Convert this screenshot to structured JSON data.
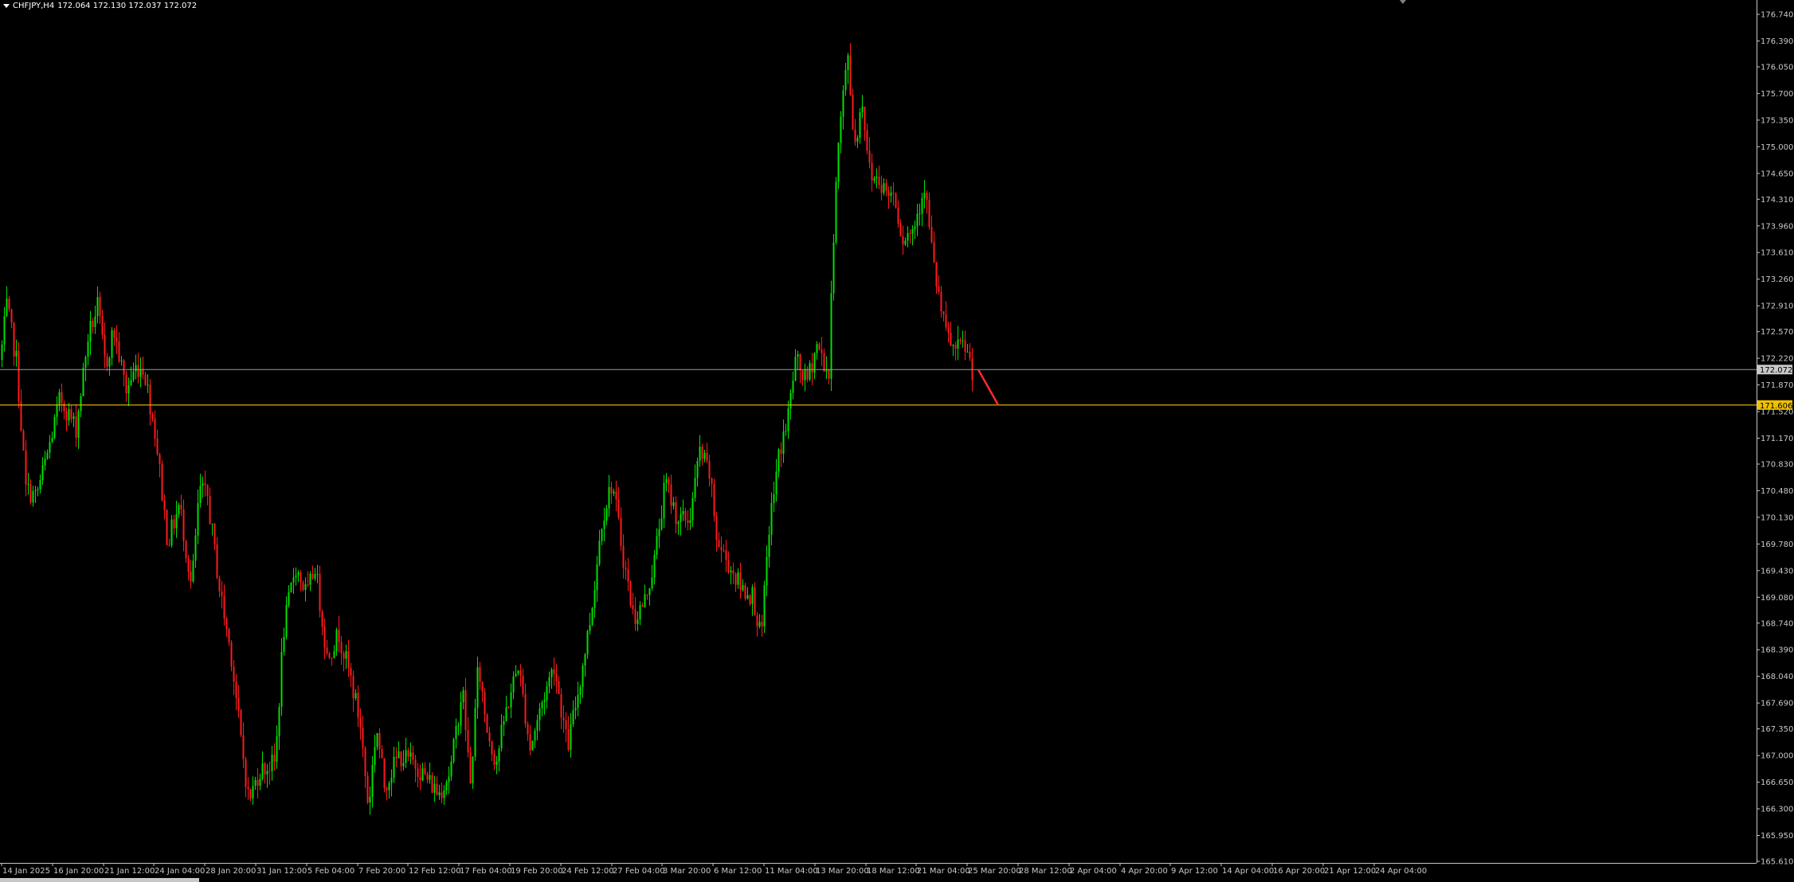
{
  "header": {
    "symbol": "CHFJPY,H4",
    "ohlc": "172.064 172.130 172.037 172.072"
  },
  "colors": {
    "background": "#000000",
    "bull": "#00e000",
    "bear": "#ff1a1a",
    "axis": "#c8c8c8",
    "bid_line": "#9a9a9a",
    "level_line": "#f0c000",
    "trend_line": "#ff2a2a"
  },
  "price_labels": {
    "current": "172.072",
    "level": "171.606"
  },
  "chart_data": {
    "type": "candlestick",
    "timeframe": "H4",
    "y_ticks": [
      "176.740",
      "176.390",
      "176.050",
      "175.700",
      "175.350",
      "175.000",
      "174.650",
      "174.310",
      "173.960",
      "173.610",
      "173.260",
      "172.910",
      "172.570",
      "172.220",
      "171.870",
      "171.520",
      "171.170",
      "170.830",
      "170.480",
      "170.130",
      "169.780",
      "169.430",
      "169.080",
      "168.740",
      "168.390",
      "168.040",
      "167.690",
      "167.350",
      "167.000",
      "166.650",
      "166.300",
      "165.950",
      "165.610"
    ],
    "x_ticks": [
      "14 Jan 2025",
      "16 Jan 20:00",
      "21 Jan 12:00",
      "24 Jan 04:00",
      "28 Jan 20:00",
      "31 Jan 12:00",
      "5 Feb 04:00",
      "7 Feb 20:00",
      "12 Feb 12:00",
      "17 Feb 04:00",
      "19 Feb 20:00",
      "24 Feb 12:00",
      "27 Feb 04:00",
      "3 Mar 20:00",
      "6 Mar 12:00",
      "11 Mar 04:00",
      "13 Mar 20:00",
      "18 Mar 12:00",
      "21 Mar 04:00",
      "25 Mar 20:00",
      "28 Mar 12:00",
      "2 Apr 04:00",
      "4 Apr 20:00",
      "9 Apr 12:00",
      "14 Apr 04:00",
      "16 Apr 20:00",
      "21 Apr 12:00",
      "24 Apr 04:00"
    ],
    "ylim": [
      165.61,
      176.74
    ],
    "current_price": 172.072,
    "horizontal_level": 171.606,
    "anchors": [
      [
        0,
        172.2
      ],
      [
        8,
        172.9
      ],
      [
        20,
        172.2
      ],
      [
        32,
        170.5
      ],
      [
        45,
        170.4
      ],
      [
        60,
        171.0
      ],
      [
        75,
        171.7
      ],
      [
        95,
        171.3
      ],
      [
        110,
        172.5
      ],
      [
        122,
        172.9
      ],
      [
        132,
        172.1
      ],
      [
        142,
        172.6
      ],
      [
        158,
        171.8
      ],
      [
        170,
        172.1
      ],
      [
        180,
        172.1
      ],
      [
        195,
        171.2
      ],
      [
        210,
        169.8
      ],
      [
        225,
        170.3
      ],
      [
        240,
        169.2
      ],
      [
        250,
        170.5
      ],
      [
        260,
        170.4
      ],
      [
        275,
        169.2
      ],
      [
        290,
        168.3
      ],
      [
        302,
        167.2
      ],
      [
        312,
        166.4
      ],
      [
        325,
        166.8
      ],
      [
        345,
        166.9
      ],
      [
        355,
        168.6
      ],
      [
        370,
        169.5
      ],
      [
        385,
        169.1
      ],
      [
        395,
        169.5
      ],
      [
        410,
        168.3
      ],
      [
        425,
        168.6
      ],
      [
        440,
        168.0
      ],
      [
        452,
        167.4
      ],
      [
        462,
        166.3
      ],
      [
        472,
        167.4
      ],
      [
        482,
        166.6
      ],
      [
        500,
        167.0
      ],
      [
        520,
        166.9
      ],
      [
        535,
        166.7
      ],
      [
        550,
        166.5
      ],
      [
        565,
        166.8
      ],
      [
        580,
        167.9
      ],
      [
        590,
        166.6
      ],
      [
        600,
        168.2
      ],
      [
        610,
        167.4
      ],
      [
        622,
        166.9
      ],
      [
        635,
        167.6
      ],
      [
        650,
        168.2
      ],
      [
        665,
        167.1
      ],
      [
        680,
        167.7
      ],
      [
        695,
        168.2
      ],
      [
        712,
        167.1
      ],
      [
        728,
        168.0
      ],
      [
        742,
        168.9
      ],
      [
        755,
        170.1
      ],
      [
        768,
        170.6
      ],
      [
        782,
        169.6
      ],
      [
        795,
        168.8
      ],
      [
        808,
        169.0
      ],
      [
        820,
        169.5
      ],
      [
        835,
        170.6
      ],
      [
        850,
        170.1
      ],
      [
        865,
        170.1
      ],
      [
        878,
        171.0
      ],
      [
        890,
        170.7
      ],
      [
        900,
        169.8
      ],
      [
        915,
        169.5
      ],
      [
        930,
        169.2
      ],
      [
        945,
        169.1
      ],
      [
        955,
        168.5
      ],
      [
        965,
        170.0
      ],
      [
        978,
        171.0
      ],
      [
        988,
        171.4
      ],
      [
        998,
        172.2
      ],
      [
        1012,
        171.9
      ],
      [
        1025,
        172.4
      ],
      [
        1040,
        172.0
      ],
      [
        1048,
        174.5
      ],
      [
        1056,
        175.5
      ],
      [
        1064,
        176.2
      ],
      [
        1072,
        175.0
      ],
      [
        1082,
        175.6
      ],
      [
        1092,
        174.6
      ],
      [
        1102,
        174.6
      ],
      [
        1112,
        174.4
      ],
      [
        1122,
        174.4
      ],
      [
        1132,
        173.8
      ],
      [
        1145,
        173.9
      ],
      [
        1160,
        174.5
      ],
      [
        1172,
        173.4
      ],
      [
        1185,
        172.6
      ],
      [
        1198,
        172.3
      ],
      [
        1210,
        172.4
      ],
      [
        1220,
        172.07
      ]
    ],
    "trendline": {
      "from": [
        1228,
        172.072
      ],
      "to": [
        1253,
        171.606
      ]
    }
  }
}
